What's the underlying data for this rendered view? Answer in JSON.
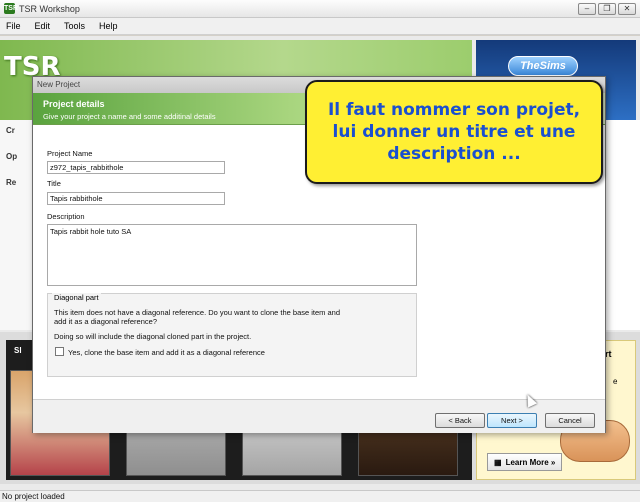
{
  "app": {
    "title": "TSR Workshop",
    "icon": "TSR"
  },
  "window_controls": [
    "minimize-icon",
    "restore-icon",
    "close-icon"
  ],
  "menu": [
    "File",
    "Edit",
    "Tools",
    "Help"
  ],
  "background": {
    "logo": "TSR",
    "sims_logo": "TheSims",
    "learn_more": "Learn More »",
    "left_items": [
      "Cr",
      "Op",
      "Re"
    ],
    "right_labels": [
      "rt",
      "e"
    ],
    "bottom_label": "Sl"
  },
  "dialog": {
    "title": "New Project",
    "header": "Project details",
    "subheader": "Give your project a name and some additinal details",
    "project_name_label": "Project Name",
    "project_name_value": "z972_tapis_rabbithole",
    "title_label": "Title",
    "title_value": "Tapis rabbithole",
    "description_label": "Description",
    "description_value": "Tapis rabbit hole tuto SA",
    "diagonal": {
      "group_title": "Diagonal part",
      "text1": "This item does not have a diagonal reference. Do you want to clone the base item and add it as a diagonal reference?",
      "text2": "Doing so will include the diagonal cloned part in the project.",
      "checkbox_label": "Yes, clone the base item and add it as a diagonal reference",
      "checked": false
    },
    "buttons": {
      "back": "< Back",
      "next": "Next >",
      "cancel": "Cancel"
    }
  },
  "callout": "Il faut nommer son projet, lui donner un titre et une description ...",
  "status": "No project loaded",
  "colors": {
    "banner_green": "#5aa33e",
    "callout_bg": "#ffef33",
    "callout_text": "#1a4fd0"
  }
}
